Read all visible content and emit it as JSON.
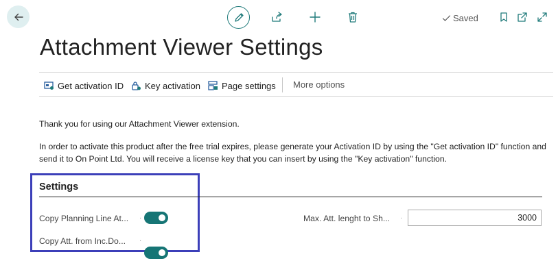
{
  "header": {
    "saved_label": "Saved"
  },
  "page": {
    "title": "Attachment Viewer Settings"
  },
  "actions": [
    {
      "label": "Get activation ID",
      "icon": "activation-id-icon"
    },
    {
      "label": "Key activation",
      "icon": "key-activation-icon"
    },
    {
      "label": "Page settings",
      "icon": "page-settings-icon"
    }
  ],
  "more_options_label": "More options",
  "intro": {
    "line1": "Thank you for using our Attachment Viewer extension.",
    "line2": "In order to activate this product after the free trial expires, please generate your Activation ID by using the \"Get activation ID\" function and send it to On Point Ltd. You will receive a license key that you can insert by using the \"Key activation\" function."
  },
  "settings": {
    "title": "Settings",
    "fields": [
      {
        "label": "Copy Planning Line At...",
        "type": "toggle",
        "value": true
      },
      {
        "label": "Copy Att. from Inc.Do...",
        "type": "toggle",
        "value": true
      },
      {
        "label": "Max. Att. lenght to Sh...",
        "type": "number",
        "value": "3000"
      }
    ]
  },
  "colors": {
    "accent": "#167575",
    "highlight_border": "#3c3fb9",
    "back_button_bg": "#dfeff0"
  }
}
